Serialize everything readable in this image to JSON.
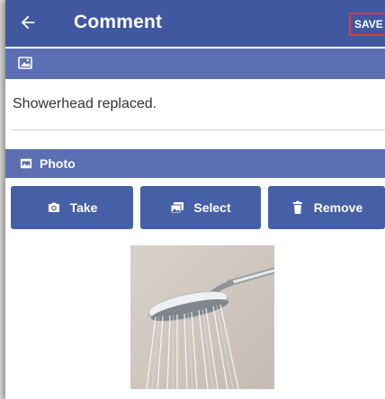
{
  "appbar": {
    "title": "Comment",
    "save_label": "SAVE"
  },
  "comment": {
    "text": "Showerhead replaced."
  },
  "photo_section": {
    "label": "Photo"
  },
  "buttons": {
    "take": "Take",
    "select": "Select",
    "remove": "Remove"
  },
  "icons": {
    "back": "back-arrow-icon",
    "image": "image-icon",
    "photo": "photo-icon",
    "take": "camera-icon",
    "select": "gallery-icon",
    "remove": "trash-icon"
  },
  "colors": {
    "appbar": "#3f58a0",
    "bar": "#5b6fb2",
    "button": "#4660a8",
    "save_outline": "#e23b3b"
  }
}
